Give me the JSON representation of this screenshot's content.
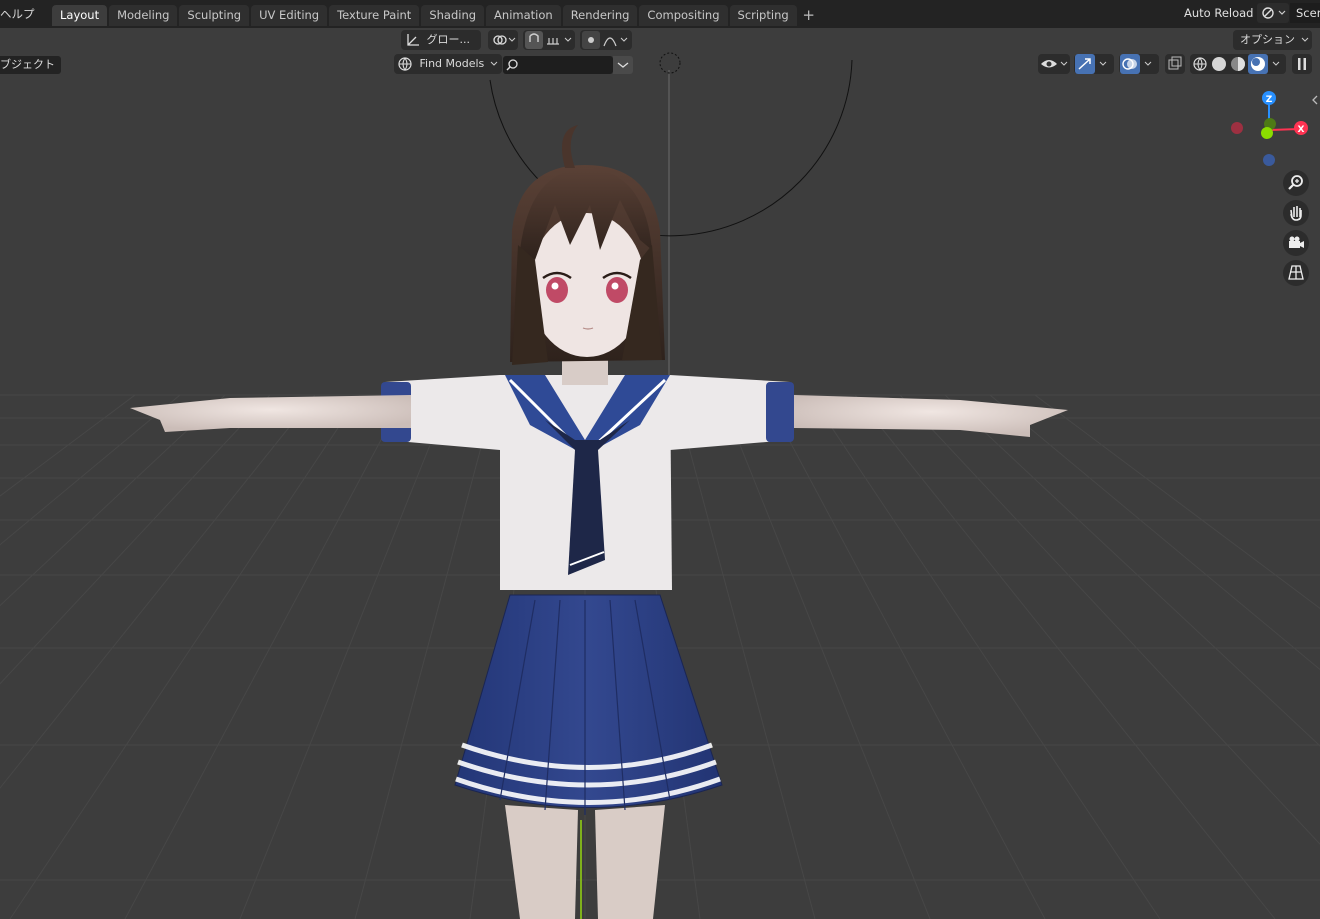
{
  "menu": {
    "help": "ヘルプ"
  },
  "workspace_tabs": [
    {
      "label": "Layout",
      "active": true
    },
    {
      "label": "Modeling"
    },
    {
      "label": "Sculpting"
    },
    {
      "label": "UV Editing"
    },
    {
      "label": "Texture Paint"
    },
    {
      "label": "Shading"
    },
    {
      "label": "Animation"
    },
    {
      "label": "Rendering"
    },
    {
      "label": "Compositing"
    },
    {
      "label": "Scripting"
    }
  ],
  "tab_add": "+",
  "top_right": {
    "auto_reload": "Auto Reload",
    "scene": "Scen"
  },
  "viewport_header": {
    "object_mode": "ブジェクト",
    "transform_orientation": "グロー...",
    "find_models": "Find Models",
    "options": "オプション"
  },
  "gizmo": {
    "z": "Z",
    "x": "X",
    "y": "Y"
  },
  "colors": {
    "background": "#3d3d3d",
    "topbar": "#232323",
    "accent_blue": "#4772b3",
    "axis_x": "#ff3352",
    "axis_y": "#8bdc00",
    "axis_z": "#2890ff"
  },
  "icons": [
    "globe-icon",
    "search-icon",
    "eye-icon",
    "gizmo-icon",
    "overlay-icon",
    "xray-icon",
    "wireframe-shading-icon",
    "solid-shading-icon",
    "material-shading-icon",
    "rendered-shading-icon",
    "zoom-icon",
    "hand-icon",
    "camera-icon",
    "grid-icon"
  ]
}
